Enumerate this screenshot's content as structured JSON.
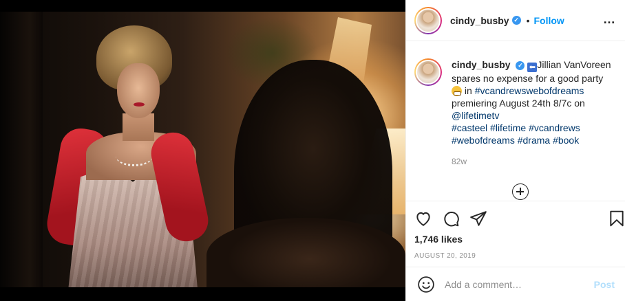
{
  "post": {
    "image_alt": "photo"
  },
  "header": {
    "username": "cindy_busby",
    "separator": "•",
    "follow_label": "Follow",
    "more_icon": "…"
  },
  "caption": {
    "username": "cindy_busby",
    "arrow_emoji": "⬅",
    "text_1": "Jillian VanVoreen spares no expense for a good party",
    "text_2": " in ",
    "hashtag_1": "#vcandrewswebofdreams",
    "text_3": " premiering August 24th 8/7c on ",
    "mention": "@lifetimetv",
    "hashtags": [
      "#casteel",
      "#lifetime",
      "#vcandrews",
      "#webofdreams",
      "#drama",
      "#book"
    ],
    "time_ago": "82w"
  },
  "actions": {
    "likes": "1,746 likes",
    "date": "AUGUST 20, 2019"
  },
  "comment": {
    "placeholder": "Add a comment…",
    "post_label": "Post"
  },
  "colors": {
    "accent": "#0095f6",
    "verified": "#3897f0",
    "post_disabled": "#b2dffc",
    "muted": "#8e8e8e"
  },
  "icons": [
    "more-icon",
    "verified-icon",
    "load-more-icon",
    "heart-icon",
    "comment-icon",
    "share-icon",
    "bookmark-icon",
    "emoji-icon"
  ]
}
